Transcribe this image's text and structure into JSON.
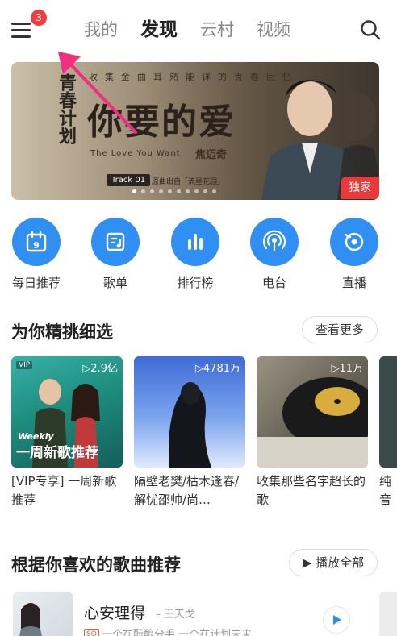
{
  "header": {
    "badge": "3",
    "tabs": [
      "我的",
      "发现",
      "云村",
      "视频"
    ],
    "active_tab": 1
  },
  "banner": {
    "logo_text": "青春计划",
    "subtitle": "收集金曲耳熟能详的青春回忆",
    "title": "你要的爱",
    "english_title": "The Love You Want",
    "artist": "焦迈奇",
    "track": "Track 01",
    "from": "原曲出自「流星花园」",
    "tag": "独家"
  },
  "quick_links": [
    {
      "label": "每日推荐",
      "icon": "calendar-icon"
    },
    {
      "label": "歌单",
      "icon": "playlist-icon"
    },
    {
      "label": "排行榜",
      "icon": "chart-bars-icon"
    },
    {
      "label": "电台",
      "icon": "radio-icon"
    },
    {
      "label": "直播",
      "icon": "live-icon"
    }
  ],
  "picks": {
    "title": "为你精挑细选",
    "more": "查看更多",
    "cards": [
      {
        "count": "▷2.9亿",
        "title": "[VIP专享] 一周新歌推荐",
        "vip": "VIP",
        "overlay": "一周新歌推荐",
        "overlay_small": "Weekly"
      },
      {
        "count": "▷4781万",
        "title": "隔壁老樊/枯木逢春/解忧邵帅/尚…"
      },
      {
        "count": "▷11万",
        "title": "收集那些名字超长的歌"
      },
      {
        "count": "",
        "title": "纯音想对"
      }
    ]
  },
  "recommend": {
    "title": "根据你喜欢的歌曲推荐",
    "play_all": "▶ 播放全部",
    "song": {
      "name": "心安理得",
      "artist": "- 王天戈",
      "quality": "SQ",
      "desc": "一个在酝酿分手 一个在计划未来"
    }
  },
  "colors": {
    "accent_blue": "#2f8ff2",
    "badge_red": "#f03d3d",
    "arrow_pink": "#f0307e"
  }
}
